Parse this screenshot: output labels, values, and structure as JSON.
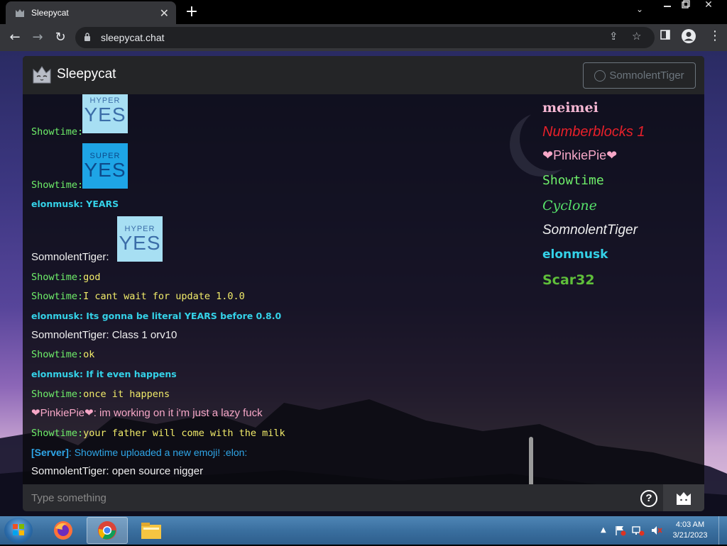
{
  "browser": {
    "tab_title": "Sleepycat",
    "url": "sleepycat.chat"
  },
  "app": {
    "brand": "Sleepycat",
    "current_user": "SomnolentTiger"
  },
  "messages": [
    {
      "name": "Showtime",
      "text": "",
      "emoji": {
        "top": "HYPER",
        "bottom": "YES",
        "bg": "#a7dff3"
      }
    },
    {
      "name": "Showtime",
      "text": "",
      "emoji": {
        "top": "SUPER",
        "bottom": "YES",
        "bg": "#1ea5e6"
      }
    },
    {
      "name": "elonmusk",
      "text": "YEARS"
    },
    {
      "name": "SomnolentTiger",
      "text": "",
      "emoji": {
        "top": "HYPER",
        "bottom": "YES",
        "bg": "#a7dff3"
      }
    },
    {
      "name": "Showtime",
      "text": "god"
    },
    {
      "name": "Showtime",
      "text": "I cant wait for update 1.0.0"
    },
    {
      "name": "elonmusk",
      "text": "Its gonna be literal YEARS before 0.8.0"
    },
    {
      "name": "SomnolentTiger",
      "text": "Class 1 orv10"
    },
    {
      "name": "Showtime",
      "text": "ok"
    },
    {
      "name": "elonmusk",
      "text": "If it even happens"
    },
    {
      "name": "Showtime",
      "text": "once it happens"
    },
    {
      "name": "PinkiePie",
      "text": "im working on it i'm just a lazy fuck"
    },
    {
      "name": "Showtime",
      "text": "your father will come with the milk"
    },
    {
      "name": "[Server]",
      "text": "Showtime uploaded a new emoji! :elon:"
    },
    {
      "name": "SomnolentTiger",
      "text": "open source nigger"
    }
  ],
  "users": [
    {
      "name": "meimei",
      "color": "#f6b7d3"
    },
    {
      "name": "Numberblocks 1",
      "color": "#e8202a"
    },
    {
      "name": "PinkiePie",
      "color": "#f6a7c7"
    },
    {
      "name": "Showtime",
      "color": "#6ff06a"
    },
    {
      "name": "Cyclone",
      "color": "#56e06a"
    },
    {
      "name": "SomnolentTiger",
      "color": "#f0f0f0"
    },
    {
      "name": "elonmusk",
      "color": "#34d2e8"
    },
    {
      "name": "Scar32",
      "color": "#5fbf3a"
    }
  ],
  "input": {
    "placeholder": "Type something"
  },
  "taskbar": {
    "time": "4:03 AM",
    "date": "3/21/2023"
  }
}
